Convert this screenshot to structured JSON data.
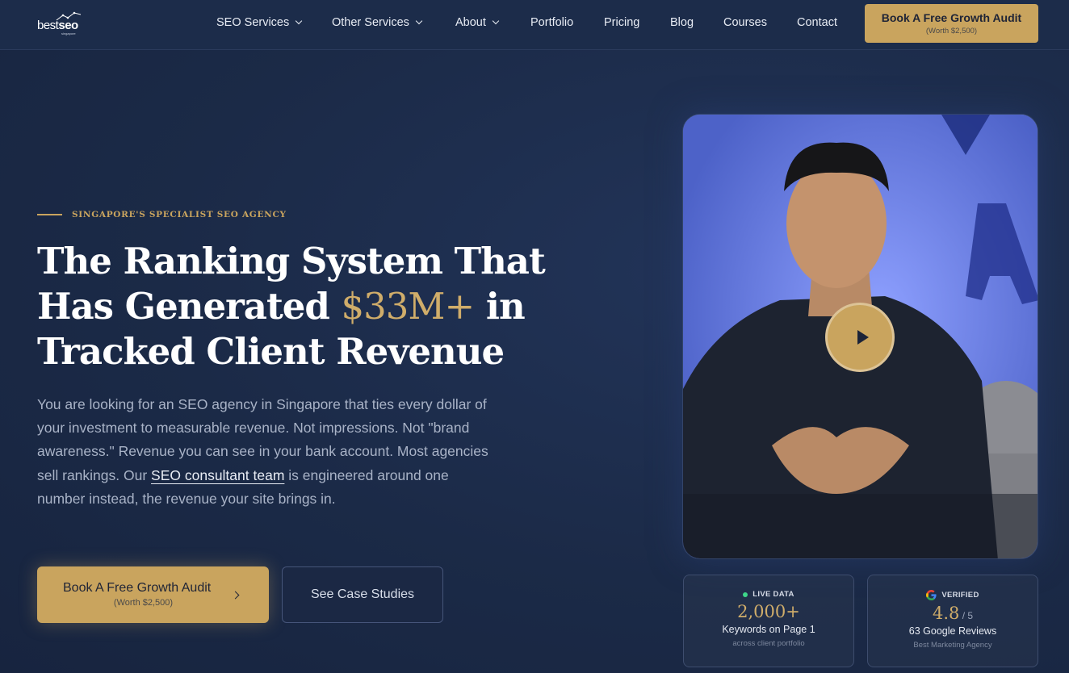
{
  "header": {
    "logo_text_light": "best",
    "logo_text_bold": "seo",
    "logo_sub": "singapore",
    "nav": [
      {
        "label": "SEO Services",
        "has_dropdown": true
      },
      {
        "label": "Other Services",
        "has_dropdown": true
      },
      {
        "label": "About",
        "has_dropdown": true
      },
      {
        "label": "Portfolio",
        "has_dropdown": false
      },
      {
        "label": "Pricing",
        "has_dropdown": false
      },
      {
        "label": "Blog",
        "has_dropdown": false
      },
      {
        "label": "Courses",
        "has_dropdown": false
      },
      {
        "label": "Contact",
        "has_dropdown": false
      }
    ],
    "cta_label": "Book A Free Growth Audit",
    "cta_sub": "(Worth $2,500)"
  },
  "hero": {
    "eyebrow": "SINGAPORE'S SPECIALIST SEO AGENCY",
    "headline_part1": "The Ranking System That Has Generated ",
    "headline_highlight": "$33M+",
    "headline_part2": " in Tracked Client Revenue",
    "body_part1": "You are looking for an SEO agency in Singapore that ties every dollar of your investment to measurable revenue. Not impressions. Not \"brand awareness.\" Revenue you can see in your bank account. Most agencies sell rankings. Our ",
    "body_link": "SEO consultant team",
    "body_part2": " is engineered around one number instead, the revenue your site brings in.",
    "primary_button": "Book A Free Growth Audit",
    "primary_button_sub": "(Worth $2,500)",
    "secondary_button": "See Case Studies"
  },
  "video": {
    "play_icon": "play-icon"
  },
  "stats": [
    {
      "tag": "LIVE DATA",
      "value": "2,000+",
      "value_suffix": "",
      "label": "Keywords on Page 1",
      "sub": "across client portfolio"
    },
    {
      "tag": "VERIFIED",
      "value": "4.8",
      "value_suffix": " / 5",
      "label": "63 Google Reviews",
      "sub": "Best Marketing Agency"
    }
  ],
  "colors": {
    "background": "#1b2a47",
    "accent_gold": "#c9a45e",
    "live_dot": "#3ed68a"
  }
}
